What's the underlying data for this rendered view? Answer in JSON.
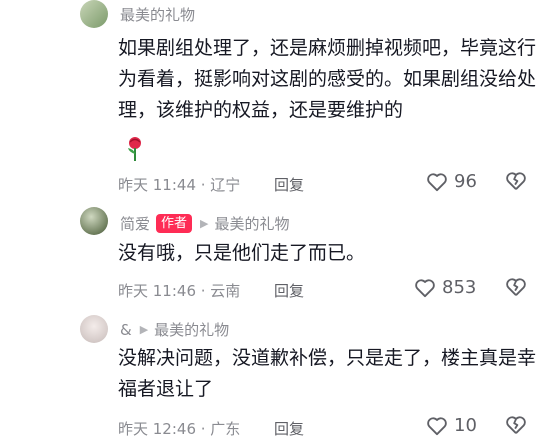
{
  "comments": [
    {
      "name": "最美的礼物",
      "text": "如果剧组处理了，还是麻烦删掉视频吧，毕竟这行为看着，挺影响对这剧的感受的。如果剧组没给处理，该维护的权益，还是要维护的",
      "time": "昨天 11:44 · 辽宁",
      "reply": "回复",
      "likes": "96"
    },
    {
      "name": "简爱",
      "author_badge": "作者",
      "reply_to": "最美的礼物",
      "text": "没有哦，只是他们走了而已。",
      "time": "昨天 11:46 · 云南",
      "reply": "回复",
      "likes": "853"
    },
    {
      "name": "&",
      "reply_to": "最美的礼物",
      "text": "没解决问题，没道歉补偿，只是走了，楼主真是幸福者退让了",
      "time": "昨天 12:46 · 广东",
      "reply": "回复",
      "likes": "10"
    }
  ],
  "icons": {
    "emoji": "rose-emoji-icon",
    "like": "heart-outline-icon",
    "dislike": "broken-heart-icon",
    "arrow": "triangle-right-icon"
  },
  "colors": {
    "badge": "#fe2c55",
    "meta": "#8a8b91",
    "text": "#161823"
  }
}
